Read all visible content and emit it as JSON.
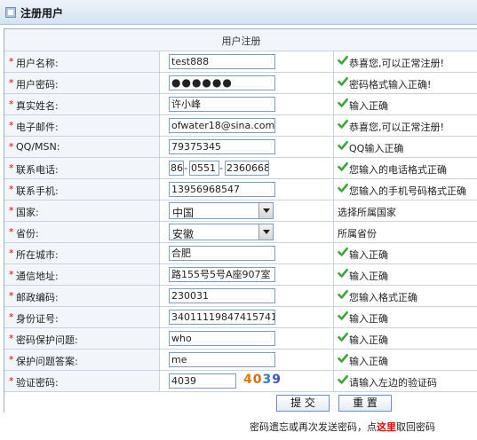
{
  "title": "注册用户",
  "table_header": "用户注册",
  "fields": [
    {
      "label": "用户名称:",
      "type": "text",
      "value": "test888",
      "tip": "恭喜您,可以正常注册!",
      "ok": true
    },
    {
      "label": "用户密码:",
      "type": "password",
      "value": "●●●●●●",
      "tip": "密码格式输入正确!",
      "ok": true
    },
    {
      "label": "真实姓名:",
      "type": "text",
      "value": "许小峰",
      "tip": "输入正确",
      "ok": true
    },
    {
      "label": "电子邮件:",
      "type": "text",
      "value": "ofwater18@sina.com",
      "tip": "恭喜您,可以正常注册!",
      "ok": true
    },
    {
      "label": "QQ/MSN:",
      "type": "text",
      "value": "79375345",
      "tip": "QQ输入正确",
      "ok": true
    },
    {
      "label": "联系电话:",
      "type": "phone",
      "value": "",
      "phone": {
        "area": "86",
        "city": "0551",
        "number": "2360668"
      },
      "tip": "您输入的电话格式正确",
      "ok": true
    },
    {
      "label": "联系手机:",
      "type": "text",
      "value": "13956968547",
      "tip": "您输入的手机号码格式正确",
      "ok": true
    },
    {
      "label": "国家:",
      "type": "select",
      "value": "中国",
      "tip": "选择所属国家",
      "ok": false
    },
    {
      "label": "省份:",
      "type": "select",
      "value": "安徽",
      "tip": "所属省份",
      "ok": false
    },
    {
      "label": "所在城市:",
      "type": "text",
      "value": "合肥",
      "tip": "输入正确",
      "ok": true
    },
    {
      "label": "通信地址:",
      "type": "text",
      "value": "路155号5号A座907室",
      "tip": "输入正确",
      "ok": true
    },
    {
      "label": "邮政编码:",
      "type": "text",
      "value": "230031",
      "tip": "您输入格式正确",
      "ok": true
    },
    {
      "label": "身份证号:",
      "type": "text",
      "value": "340111198474157​41",
      "tip": "输入正确",
      "ok": true
    },
    {
      "label": "密码保护问题:",
      "type": "text",
      "value": "who",
      "tip": "输入正确",
      "ok": true
    },
    {
      "label": "保护问题答案:",
      "type": "text",
      "value": "me",
      "tip": "输入正确",
      "ok": true
    },
    {
      "label": "验证密码:",
      "type": "captcha",
      "value": "4039",
      "captcha": "4039",
      "tip": "请输入左边的验证码",
      "ok": true
    }
  ],
  "required_mark": "*",
  "buttons": {
    "submit": "提 交",
    "reset": "重 置"
  },
  "footer": {
    "before": "密码遗忘或再次发送密码，点",
    "link": "这里",
    "after": "取回密码"
  },
  "colors": {
    "required": "#e00000",
    "ok_icon": "#3aa435",
    "label_bg": "#f2f6fb",
    "border": "#c5d3e4"
  }
}
